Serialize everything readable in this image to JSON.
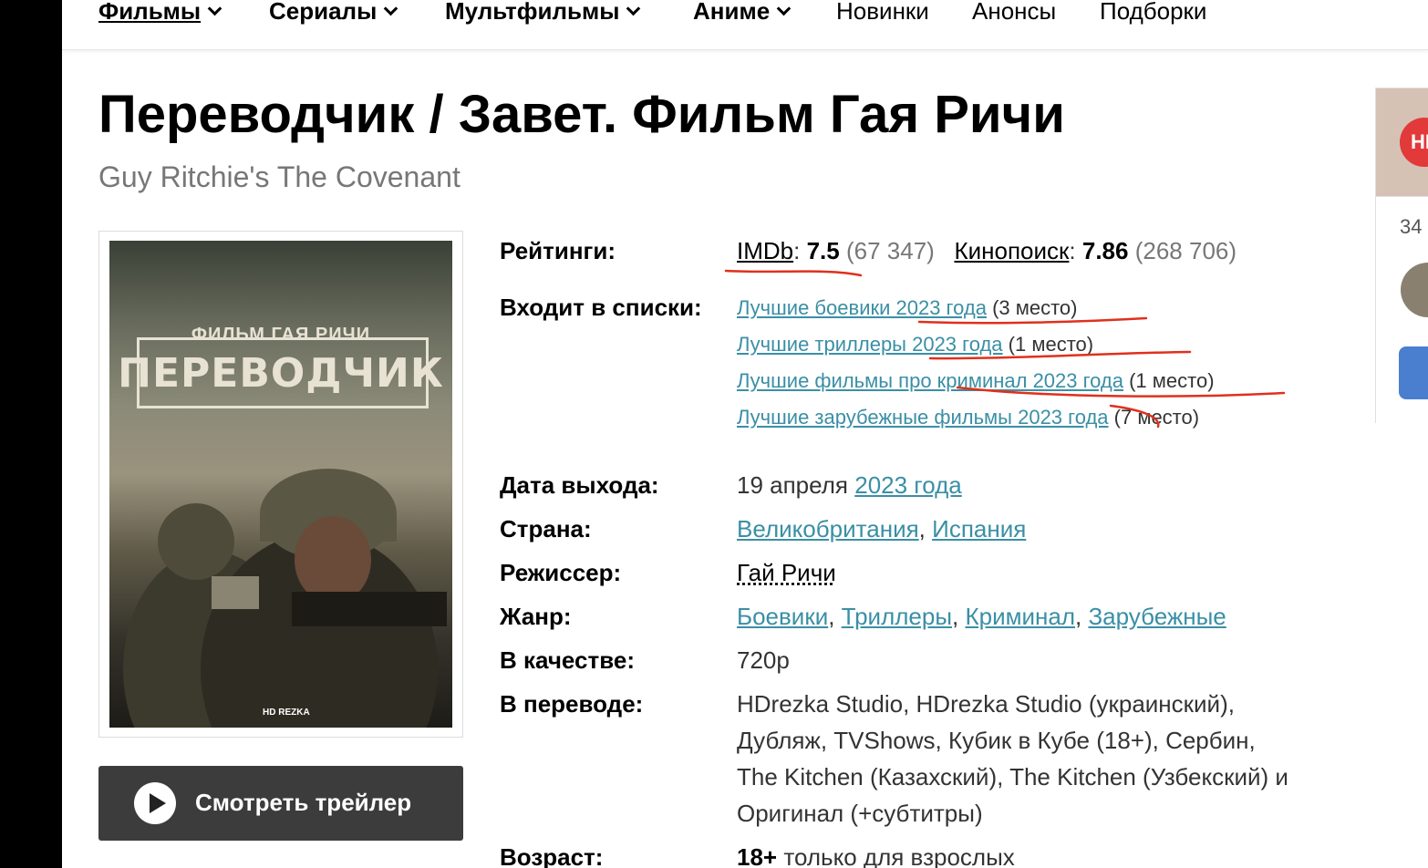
{
  "nav": {
    "items": [
      {
        "label": "Фильмы",
        "bold": true,
        "active": true,
        "dropdown": true
      },
      {
        "label": "Сериалы",
        "bold": true,
        "dropdown": true
      },
      {
        "label": "Мультфильмы",
        "bold": true,
        "dropdown": true
      },
      {
        "label": "Аниме",
        "bold": true,
        "dropdown": true
      },
      {
        "label": "Новинки"
      },
      {
        "label": "Анонсы"
      },
      {
        "label": "Подборки"
      }
    ]
  },
  "movie": {
    "title": "Переводчик / Завет. Фильм Гая Ричи",
    "original_title": "Guy Ritchie's The Covenant",
    "poster": {
      "caption": "ФИЛЬМ ГАЯ РИЧИ",
      "title": "ПЕРЕВОДЧИК",
      "logo": "HD REZKA"
    },
    "trailer_label": "Смотреть трейлер"
  },
  "info": {
    "ratings_label": "Рейтинги:",
    "imdb": {
      "name": "IMDb",
      "score": "7.5",
      "votes": "(67 347)"
    },
    "kinopoisk": {
      "name": "Кинопоиск",
      "score": "7.86",
      "votes": "(268 706)"
    },
    "lists_label": "Входит в списки:",
    "lists": [
      {
        "title": "Лучшие боевики 2023 года",
        "place": "(3 место)"
      },
      {
        "title": "Лучшие триллеры 2023 года",
        "place": "(1 место)"
      },
      {
        "title": "Лучшие фильмы про криминал 2023 года",
        "place": "(1 место)"
      },
      {
        "title": "Лучшие зарубежные фильмы 2023 года",
        "place": "(7 место)"
      }
    ],
    "release_label": "Дата выхода:",
    "release_day": "19 апреля",
    "release_year": "2023 года",
    "country_label": "Страна:",
    "countries": [
      "Великобритания",
      "Испания"
    ],
    "director_label": "Режиссер:",
    "director": "Гай Ричи",
    "genre_label": "Жанр:",
    "genres": [
      "Боевики",
      "Триллеры",
      "Криминал",
      "Зарубежные"
    ],
    "quality_label": "В качестве:",
    "quality": "720p",
    "translation_label": "В переводе:",
    "translation_lines": [
      "HDrezka Studio, HDrezka Studio (украинский),",
      "Дубляж, TVShows, Кубик в Кубе (18+), Сербин,",
      "The Kitchen (Казахский), The Kitchen (Узбекский) и",
      "Оригинал (+субтитры)"
    ],
    "age_label": "Возраст:",
    "age_value": "18+",
    "age_text": "только для взрослых"
  },
  "side": {
    "logo_text": "HD REZKA",
    "count": "34"
  },
  "colors": {
    "link": "#3a8fa5",
    "annotation": "#e0301e",
    "button": "#3c3c3c"
  }
}
